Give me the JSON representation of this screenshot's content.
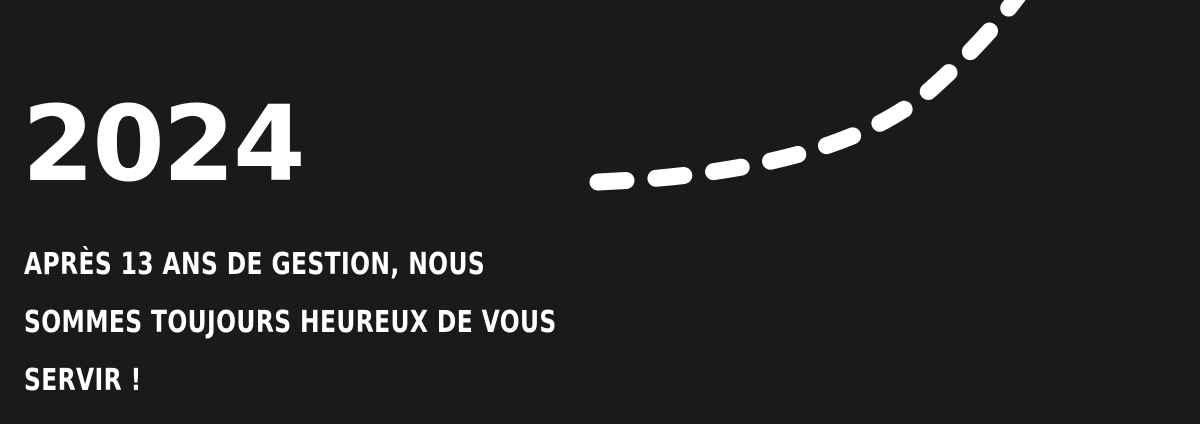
{
  "banner": {
    "year": "2024",
    "message_lines": [
      "Après 13 ans de gestion, nous",
      "sommes toujours heureux de vous",
      "servir !"
    ]
  },
  "colors": {
    "background": "#1a1a1a",
    "text": "#ffffff",
    "dashed_path": "#ffffff"
  }
}
